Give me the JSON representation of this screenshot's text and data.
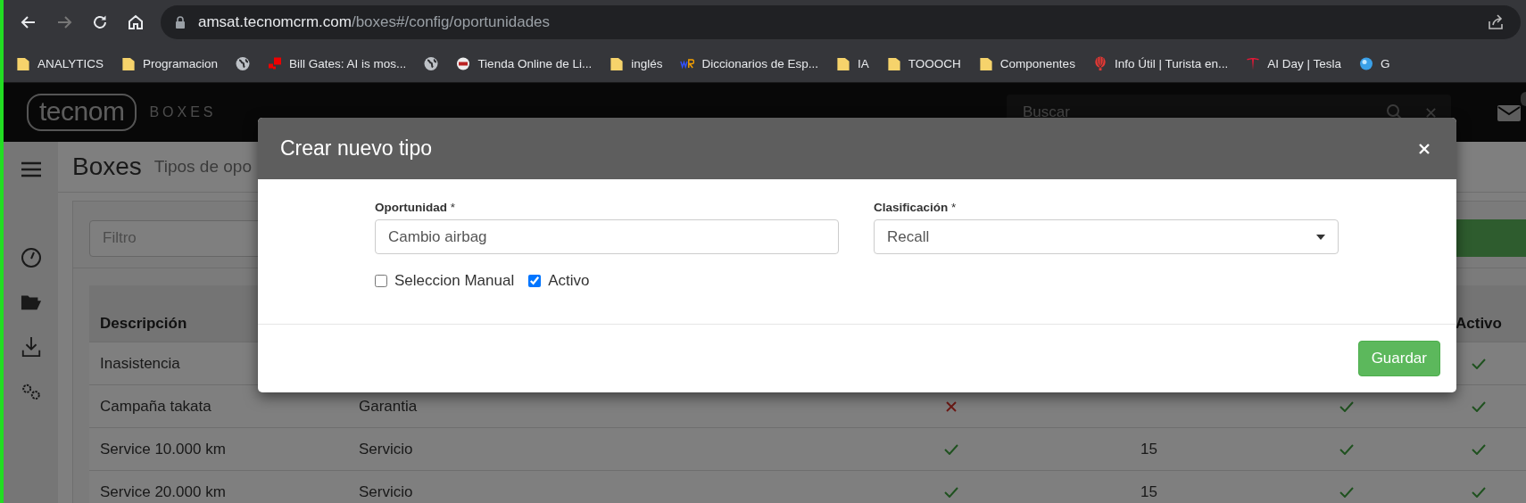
{
  "browser": {
    "url": {
      "host": "amsat.tecnomcrm.com",
      "path": "/boxes#/config/oportunidades"
    },
    "bookmarks": [
      {
        "kind": "folder",
        "label": "ANALYTICS"
      },
      {
        "kind": "folder",
        "label": "Programacion"
      },
      {
        "kind": "site"
      },
      {
        "kind": "site",
        "label": "Bill Gates: AI is mos..."
      },
      {
        "kind": "site"
      },
      {
        "kind": "site",
        "label": "Tienda Online de Li..."
      },
      {
        "kind": "folder",
        "label": "inglés"
      },
      {
        "kind": "site",
        "label": "Diccionarios de Esp..."
      },
      {
        "kind": "folder",
        "label": "IA"
      },
      {
        "kind": "folder",
        "label": "TOOOCH"
      },
      {
        "kind": "folder",
        "label": "Componentes"
      },
      {
        "kind": "site",
        "label": "Info Útil | Turista en..."
      },
      {
        "kind": "site",
        "label": "AI Day | Tesla"
      },
      {
        "kind": "site",
        "label": "G"
      }
    ]
  },
  "app": {
    "logo": "tecnom",
    "product": "BOXES",
    "search": {
      "placeholder": "Buscar"
    }
  },
  "page": {
    "title": "Boxes",
    "subtitle": "Tipos de opo",
    "filter": {
      "placeholder": "Filtro"
    }
  },
  "table": {
    "headings": {
      "descripcion": "Descripción",
      "activo": "Activo"
    },
    "rows": [
      {
        "descripcion": "Inasistencia",
        "activo": true
      },
      {
        "descripcion": "Campaña takata",
        "column_2": "Garantia",
        "column_3": false,
        "column_5": true,
        "activo": true
      },
      {
        "descripcion": "Service 10.000 km",
        "column_2": "Servicio",
        "column_3": true,
        "column_4": "15",
        "column_5": true,
        "activo": true
      },
      {
        "descripcion": "Service 20.000 km",
        "column_2": "Servicio",
        "column_3": true,
        "column_4": "15",
        "column_5": true,
        "activo": true
      }
    ]
  },
  "modal": {
    "title": "Crear nuevo tipo",
    "fields": [
      {
        "label": "**Oportunidad** *",
        "kind": "text",
        "value": "Cambio airbag"
      },
      {
        "label": "**Clasificación** *",
        "kind": "select",
        "value": "Recall"
      }
    ],
    "checkboxes": [
      {
        "label": "Seleccion Manual",
        "checked": false
      },
      {
        "label": "Activo",
        "checked": true
      }
    ],
    "save_button": "Guardar"
  }
}
